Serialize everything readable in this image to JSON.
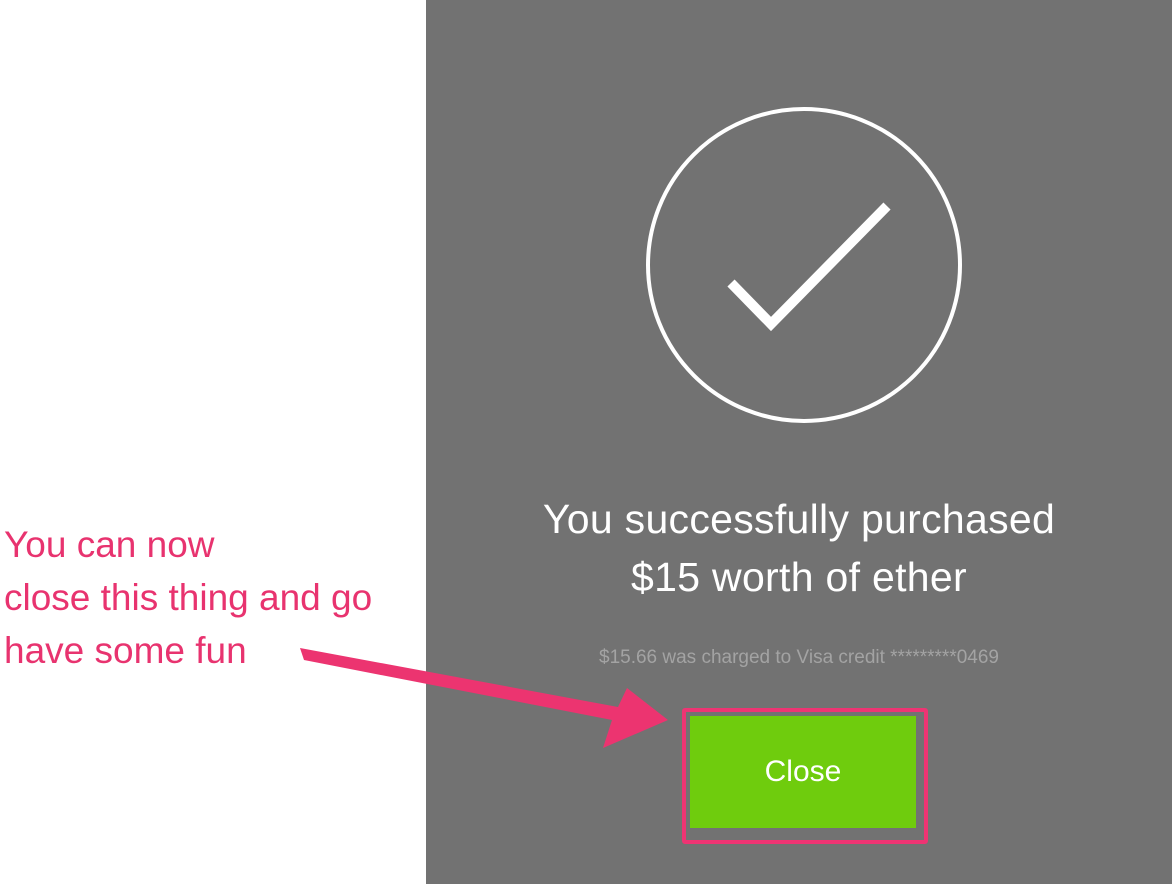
{
  "dialog": {
    "headline_line1": "You successfully purchased",
    "headline_line2": "$15 worth of ether",
    "charge_text": "$15.66 was charged to Visa credit *********0469",
    "close_label": "Close",
    "success_icon": "checkmark-circle-icon"
  },
  "annotation": {
    "line1": "You can now",
    "line2": "close this thing and go",
    "line3": "have some fun",
    "arrow_icon": "arrow-right-icon"
  },
  "colors": {
    "panel_bg": "#727272",
    "button_green": "#6fcc0d",
    "annotation_pink": "#e8336f"
  }
}
